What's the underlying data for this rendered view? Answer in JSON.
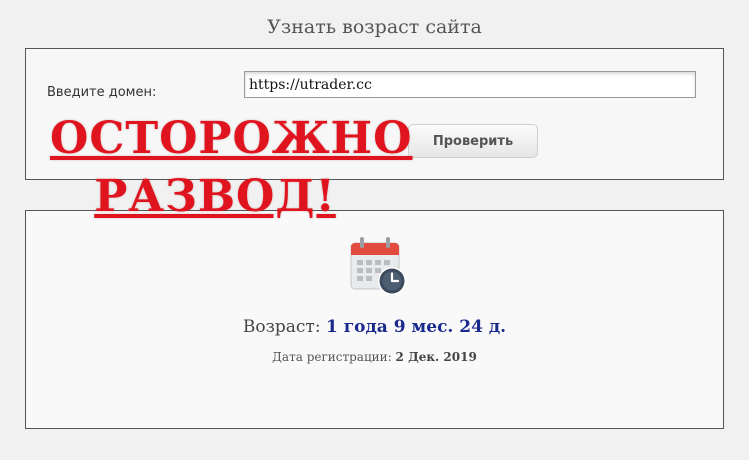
{
  "page": {
    "title": "Узнать возраст сайта"
  },
  "form": {
    "domain_label": "Введите домен:",
    "domain_value": "https://utrader.cc",
    "check_button_label": "Проверить"
  },
  "warning": {
    "line1": "ОСТОРОЖНО",
    "line2": "РАЗВОД!",
    "color": "#e0141e"
  },
  "result": {
    "age_label": "Возраст:",
    "age_value": "1 года 9 мес. 24 д.",
    "registration_label": "Дата регистрации:",
    "registration_value": "2 Дек. 2019",
    "icon": "calendar-clock-icon"
  }
}
